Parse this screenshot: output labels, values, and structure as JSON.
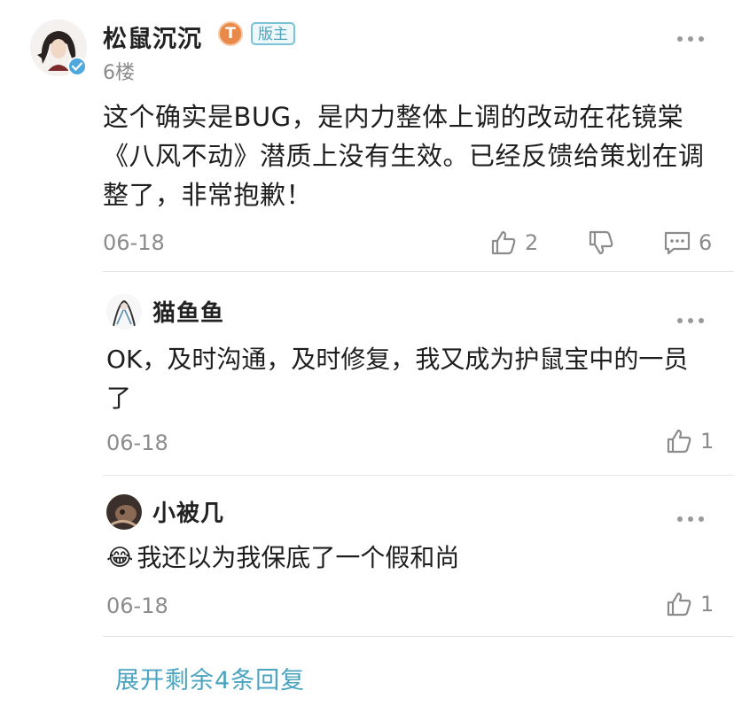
{
  "post": {
    "author": "松鼠沉沉",
    "level_badge": "T",
    "role_badge": "版主",
    "floor": "6楼",
    "content": "这个确实是BUG，是内力整体上调的改动在花镜棠《八风不动》潜质上没有生效。已经反馈给策划在调整了，非常抱歉！",
    "date": "06-18",
    "likes": "2",
    "comments": "6"
  },
  "replies": [
    {
      "author": "猫鱼鱼",
      "text": "OK，及时沟通，及时修复，我又成为护鼠宝中的一员了",
      "date": "06-18",
      "likes": "1"
    },
    {
      "author": "小被几",
      "emoji": "😂",
      "text": "我还以为我保底了一个假和尚",
      "date": "06-18",
      "likes": "1"
    }
  ],
  "expand_label": "展开剩余4条回复",
  "colors": {
    "accent": "#4aa4bf",
    "verified": "#4ea8de",
    "level_badge": "#e8894a"
  },
  "icons": [
    "more-icon",
    "like-icon",
    "dislike-icon",
    "comment-icon",
    "verified-icon"
  ]
}
